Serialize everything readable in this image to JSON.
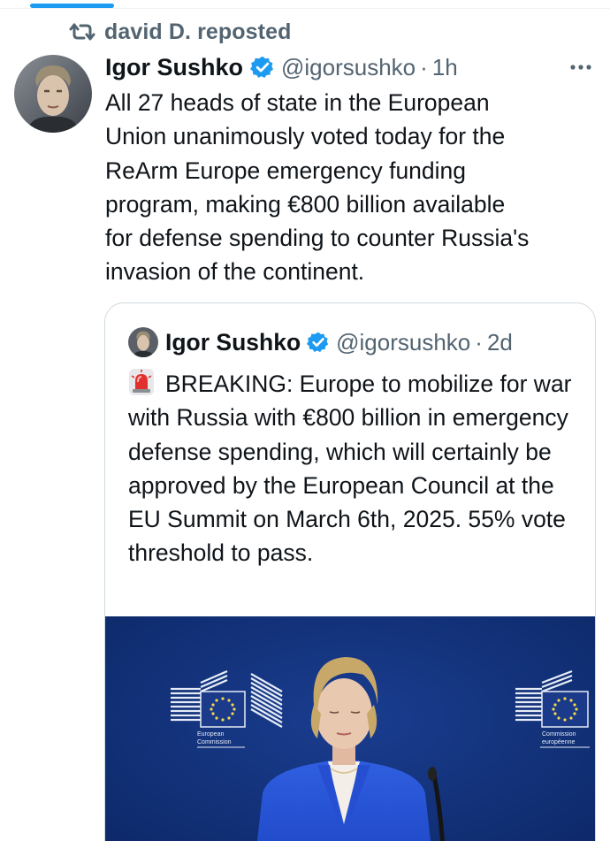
{
  "repost": {
    "text": "david D. reposted",
    "icon": "repost-icon"
  },
  "tweet": {
    "author_name": "Igor Sushko",
    "handle": "@igorsushko",
    "separator": "·",
    "time": "1h",
    "text": "All 27 heads of state in the European\nUnion unanimously voted today for the\nReArm Europe emergency funding\nprogram, making €800 billion available\nfor defense spending to counter Russia's\ninvasion of the continent."
  },
  "quote": {
    "author_name": "Igor Sushko",
    "handle": "@igorsushko",
    "separator": "·",
    "time": "2d",
    "text": "BREAKING: Europe to mobilize for war with Russia with €800 billion in emergency defense spending, which will certainly be approved by the European Council at the EU Summit on March 6th, 2025. 55% vote threshold to pass.",
    "image": {
      "logo_left_line1": "European",
      "logo_left_line2": "Commission",
      "logo_right_line1": "Commission",
      "logo_right_line2": "européenne"
    }
  },
  "colors": {
    "accent": "#1d9bf0",
    "secondary_text": "#536471",
    "primary_text": "#0f1419",
    "border": "#cfd9de",
    "image_background": "#0e2f7a"
  }
}
